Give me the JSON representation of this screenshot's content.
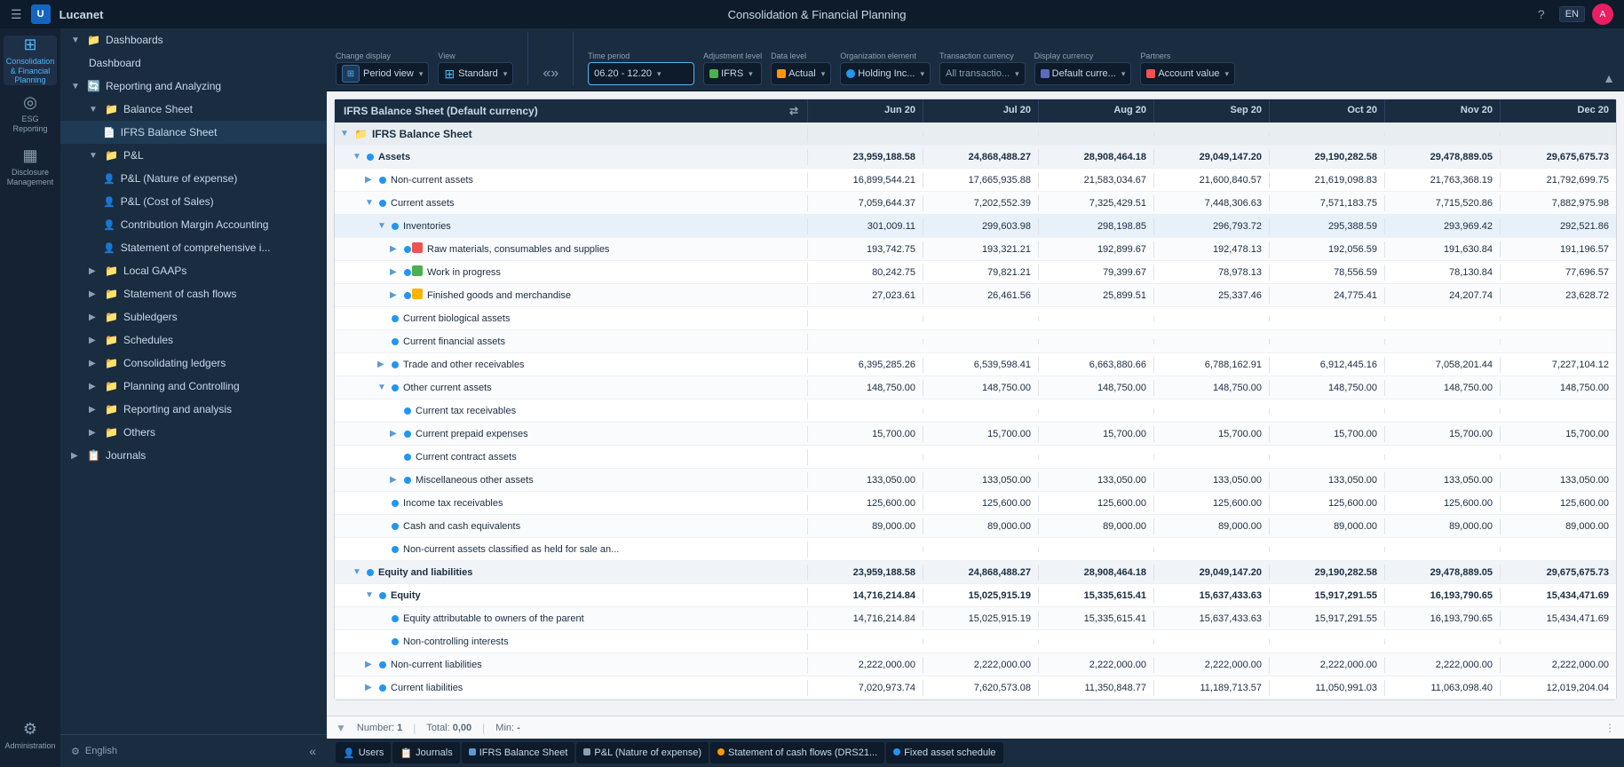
{
  "app": {
    "title": "Consolidation & Financial Planning",
    "logo": "U"
  },
  "topbar": {
    "app_name": "Lucanet",
    "title": "Consolidation & Financial Planning",
    "lang": "EN"
  },
  "nav_icons": [
    {
      "id": "consolidation",
      "symbol": "⊞",
      "label": "Consolidation & Financial Planning",
      "active": true
    },
    {
      "id": "esg",
      "symbol": "◎",
      "label": "ESG Reporting",
      "active": false
    },
    {
      "id": "disclosure",
      "symbol": "▦",
      "label": "Disclosure Management",
      "active": false
    },
    {
      "id": "admin",
      "symbol": "⚙",
      "label": "Administration",
      "active": false
    }
  ],
  "sidebar": {
    "sections": [
      {
        "id": "dashboards",
        "label": "Dashboards",
        "expanded": true,
        "indent": 0,
        "hasExpand": true,
        "folderColor": "blue"
      },
      {
        "id": "dashboard",
        "label": "Dashboard",
        "indent": 1,
        "folderColor": "none"
      },
      {
        "id": "reporting",
        "label": "Reporting and Analyzing",
        "expanded": true,
        "indent": 0,
        "hasExpand": true,
        "folderColor": "blue"
      },
      {
        "id": "balance-sheet",
        "label": "Balance Sheet",
        "expanded": true,
        "indent": 1,
        "hasExpand": true,
        "folderColor": "green"
      },
      {
        "id": "ifrs-balance",
        "label": "IFRS Balance Sheet",
        "indent": 2,
        "active": true,
        "folderColor": "none"
      },
      {
        "id": "pl",
        "label": "P&L",
        "expanded": true,
        "indent": 1,
        "hasExpand": true,
        "folderColor": "green"
      },
      {
        "id": "pl-expense",
        "label": "P&L (Nature of expense)",
        "indent": 2,
        "folderColor": "none"
      },
      {
        "id": "pl-cost",
        "label": "P&L (Cost of Sales)",
        "indent": 2,
        "folderColor": "none"
      },
      {
        "id": "contribution",
        "label": "Contribution Margin Accounting",
        "indent": 2,
        "folderColor": "none"
      },
      {
        "id": "statement-comp",
        "label": "Statement of comprehensive i...",
        "indent": 2,
        "folderColor": "none"
      },
      {
        "id": "local-gaap",
        "label": "Local GAAPs",
        "indent": 1,
        "hasExpand": true,
        "folderColor": "green"
      },
      {
        "id": "cash-flows",
        "label": "Statement of cash flows",
        "indent": 1,
        "hasExpand": true,
        "folderColor": "green"
      },
      {
        "id": "subledgers",
        "label": "Subledgers",
        "indent": 1,
        "hasExpand": true,
        "folderColor": "green"
      },
      {
        "id": "schedules",
        "label": "Schedules",
        "indent": 1,
        "hasExpand": true,
        "folderColor": "green"
      },
      {
        "id": "consolidating",
        "label": "Consolidating ledgers",
        "indent": 1,
        "hasExpand": true,
        "folderColor": "darkblue"
      },
      {
        "id": "planning",
        "label": "Planning and Controlling",
        "indent": 1,
        "hasExpand": true,
        "folderColor": "darkblue"
      },
      {
        "id": "reporting-analysis",
        "label": "Reporting and analysis",
        "indent": 1,
        "hasExpand": true,
        "folderColor": "darkblue"
      },
      {
        "id": "others",
        "label": "Others",
        "indent": 1,
        "hasExpand": true,
        "folderColor": "darkblue"
      },
      {
        "id": "journals",
        "label": "Journals",
        "indent": 0,
        "hasExpand": true,
        "folderColor": "blue"
      }
    ],
    "footer": {
      "lang_label": "English",
      "collapse_title": "Collapse sidebar"
    }
  },
  "toolbar": {
    "change_display_label": "Change display",
    "period_view_label": "Period view",
    "view_label": "View",
    "standard_label": "Standard",
    "time_period_label": "Time period",
    "time_period_value": "06.20 - 12.20",
    "adjustment_label": "Adjustment level",
    "adjustment_value": "IFRS",
    "data_level_label": "Data level",
    "data_level_value": "Actual",
    "org_element_label": "Organization element",
    "org_element_value": "Holding Inc...",
    "transaction_currency_label": "Transaction currency",
    "transaction_currency_value": "All transactio...",
    "display_currency_label": "Display currency",
    "display_currency_value": "Default curre...",
    "partners_label": "Partners",
    "partners_value": "Account value"
  },
  "table": {
    "title": "IFRS Balance Sheet (Default currency)",
    "months": [
      "Jun 20",
      "Jul 20",
      "Aug 20",
      "Sep 20",
      "Oct 20",
      "Nov 20",
      "Dec 20"
    ],
    "rows": [
      {
        "id": "ifrs-root",
        "level": 0,
        "label": "IFRS Balance Sheet",
        "isFolder": true,
        "expanded": true,
        "values": []
      },
      {
        "id": "assets",
        "level": 1,
        "label": "Assets",
        "expanded": true,
        "dot": "blue",
        "bold": true,
        "values": [
          "23,959,188.58",
          "24,868,488.27",
          "28,908,464.18",
          "29,049,147.20",
          "29,190,282.58",
          "29,478,889.05",
          "29,675,675.73"
        ]
      },
      {
        "id": "noncurrent-assets",
        "level": 2,
        "label": "Non-current assets",
        "expanded": false,
        "dot": "blue",
        "values": [
          "16,899,544.21",
          "17,665,935.88",
          "21,583,034.67",
          "21,600,840.57",
          "21,619,098.83",
          "21,763,368.19",
          "21,792,699.75"
        ]
      },
      {
        "id": "current-assets",
        "level": 2,
        "label": "Current assets",
        "expanded": true,
        "dot": "blue",
        "values": [
          "7,059,644.37",
          "7,202,552.39",
          "7,325,429.51",
          "7,448,306.63",
          "7,571,183.75",
          "7,715,520.86",
          "7,882,975.98"
        ]
      },
      {
        "id": "inventories",
        "level": 3,
        "label": "Inventories",
        "expanded": true,
        "dot": "blue",
        "highlighted": true,
        "values": [
          "301,009.11",
          "299,603.98",
          "298,198.85",
          "296,793.72",
          "295,388.59",
          "293,969.42",
          "292,521.86"
        ]
      },
      {
        "id": "raw-materials",
        "level": 4,
        "label": "Raw materials, consumables and supplies",
        "expanded": false,
        "dot": "blue",
        "icon": "red",
        "values": [
          "193,742.75",
          "193,321.21",
          "192,899.67",
          "192,478.13",
          "192,056.59",
          "191,630.84",
          "191,196.57"
        ]
      },
      {
        "id": "work-in-progress",
        "level": 4,
        "label": "Work in progress",
        "expanded": false,
        "dot": "blue",
        "icon": "green",
        "values": [
          "80,242.75",
          "79,821.21",
          "79,399.67",
          "78,978.13",
          "78,556.59",
          "78,130.84",
          "77,696.57"
        ]
      },
      {
        "id": "finished-goods",
        "level": 4,
        "label": "Finished goods and merchandise",
        "expanded": false,
        "dot": "blue",
        "icon": "yellow",
        "values": [
          "27,023.61",
          "26,461.56",
          "25,899.51",
          "25,337.46",
          "24,775.41",
          "24,207.74",
          "23,628.72"
        ]
      },
      {
        "id": "current-bio",
        "level": 3,
        "label": "Current biological assets",
        "dot": "blue",
        "values": []
      },
      {
        "id": "current-fin",
        "level": 3,
        "label": "Current financial assets",
        "dot": "blue",
        "values": []
      },
      {
        "id": "trade-receivables",
        "level": 3,
        "label": "Trade and other receivables",
        "expanded": false,
        "dot": "blue",
        "values": [
          "6,395,285.26",
          "6,539,598.41",
          "6,663,880.66",
          "6,788,162.91",
          "6,912,445.16",
          "7,058,201.44",
          "7,227,104.12"
        ]
      },
      {
        "id": "other-current",
        "level": 3,
        "label": "Other current assets",
        "expanded": true,
        "dot": "blue",
        "values": [
          "148,750.00",
          "148,750.00",
          "148,750.00",
          "148,750.00",
          "148,750.00",
          "148,750.00",
          "148,750.00"
        ]
      },
      {
        "id": "current-tax-recv",
        "level": 4,
        "label": "Current tax receivables",
        "dot": "blue",
        "values": []
      },
      {
        "id": "current-prepaid",
        "level": 4,
        "label": "Current prepaid expenses",
        "dot": "blue",
        "expanded": false,
        "values": [
          "15,700.00",
          "15,700.00",
          "15,700.00",
          "15,700.00",
          "15,700.00",
          "15,700.00",
          "15,700.00"
        ]
      },
      {
        "id": "current-contract",
        "level": 4,
        "label": "Current contract assets",
        "dot": "blue",
        "values": []
      },
      {
        "id": "misc-other",
        "level": 4,
        "label": "Miscellaneous other assets",
        "dot": "blue",
        "expanded": false,
        "values": [
          "133,050.00",
          "133,050.00",
          "133,050.00",
          "133,050.00",
          "133,050.00",
          "133,050.00",
          "133,050.00"
        ]
      },
      {
        "id": "income-tax-recv",
        "level": 3,
        "label": "Income tax receivables",
        "dot": "blue",
        "values": [
          "125,600.00",
          "125,600.00",
          "125,600.00",
          "125,600.00",
          "125,600.00",
          "125,600.00",
          "125,600.00"
        ]
      },
      {
        "id": "cash-equiv",
        "level": 3,
        "label": "Cash and cash equivalents",
        "dot": "blue",
        "values": [
          "89,000.00",
          "89,000.00",
          "89,000.00",
          "89,000.00",
          "89,000.00",
          "89,000.00",
          "89,000.00"
        ]
      },
      {
        "id": "noncurrent-held",
        "level": 3,
        "label": "Non-current assets classified as held for sale an...",
        "dot": "blue",
        "values": []
      },
      {
        "id": "equity-liabilities",
        "level": 1,
        "label": "Equity and liabilities",
        "expanded": true,
        "dot": "blue",
        "bold": true,
        "values": [
          "23,959,188.58",
          "24,868,488.27",
          "28,908,464.18",
          "29,049,147.20",
          "29,190,282.58",
          "29,478,889.05",
          "29,675,675.73"
        ]
      },
      {
        "id": "equity",
        "level": 2,
        "label": "Equity",
        "expanded": true,
        "dot": "blue",
        "bold": true,
        "values": [
          "14,716,214.84",
          "15,025,915.19",
          "15,335,615.41",
          "15,637,433.63",
          "15,917,291.55",
          "16,193,790.65",
          "15,434,471.69"
        ]
      },
      {
        "id": "equity-attr",
        "level": 3,
        "label": "Equity attributable to owners of the parent",
        "dot": "blue",
        "values": [
          "14,716,214.84",
          "15,025,915.19",
          "15,335,615.41",
          "15,637,433.63",
          "15,917,291.55",
          "16,193,790.65",
          "15,434,471.69"
        ]
      },
      {
        "id": "non-controlling",
        "level": 3,
        "label": "Non-controlling interests",
        "dot": "blue",
        "values": []
      },
      {
        "id": "noncurrent-liab",
        "level": 2,
        "label": "Non-current liabilities",
        "expanded": false,
        "dot": "blue",
        "values": [
          "2,222,000.00",
          "2,222,000.00",
          "2,222,000.00",
          "2,222,000.00",
          "2,222,000.00",
          "2,222,000.00",
          "2,222,000.00"
        ]
      },
      {
        "id": "current-liab",
        "level": 2,
        "label": "Current liabilities",
        "expanded": false,
        "dot": "blue",
        "values": [
          "7,020,973.74",
          "7,620,573.08",
          "11,350,848.77",
          "11,189,713.57",
          "11,050,991.03",
          "11,063,098.40",
          "12,019,204.04"
        ]
      }
    ]
  },
  "statusbar": {
    "number_label": "Number:",
    "number_value": "1",
    "total_label": "Total:",
    "total_value": "0,00",
    "min_label": "Min:",
    "min_value": "-"
  },
  "taskbar": {
    "items": [
      {
        "id": "users",
        "label": "Users",
        "icon": "👤",
        "dotColor": "none"
      },
      {
        "id": "journals",
        "label": "Journals",
        "icon": "📋",
        "dotColor": "none"
      },
      {
        "id": "ifrs-balance",
        "label": "IFRS Balance Sheet",
        "icon": "📊",
        "dotColor": "blue"
      },
      {
        "id": "pl-expense",
        "label": "P&L (Nature of expense)",
        "icon": "📊",
        "dotColor": "none"
      },
      {
        "id": "cash-flows-drs",
        "label": "Statement of cash flows (DRS21...",
        "icon": "●",
        "dotColor": "orange"
      },
      {
        "id": "fixed-asset",
        "label": "Fixed asset schedule",
        "icon": "●",
        "dotColor": "blue"
      }
    ]
  }
}
